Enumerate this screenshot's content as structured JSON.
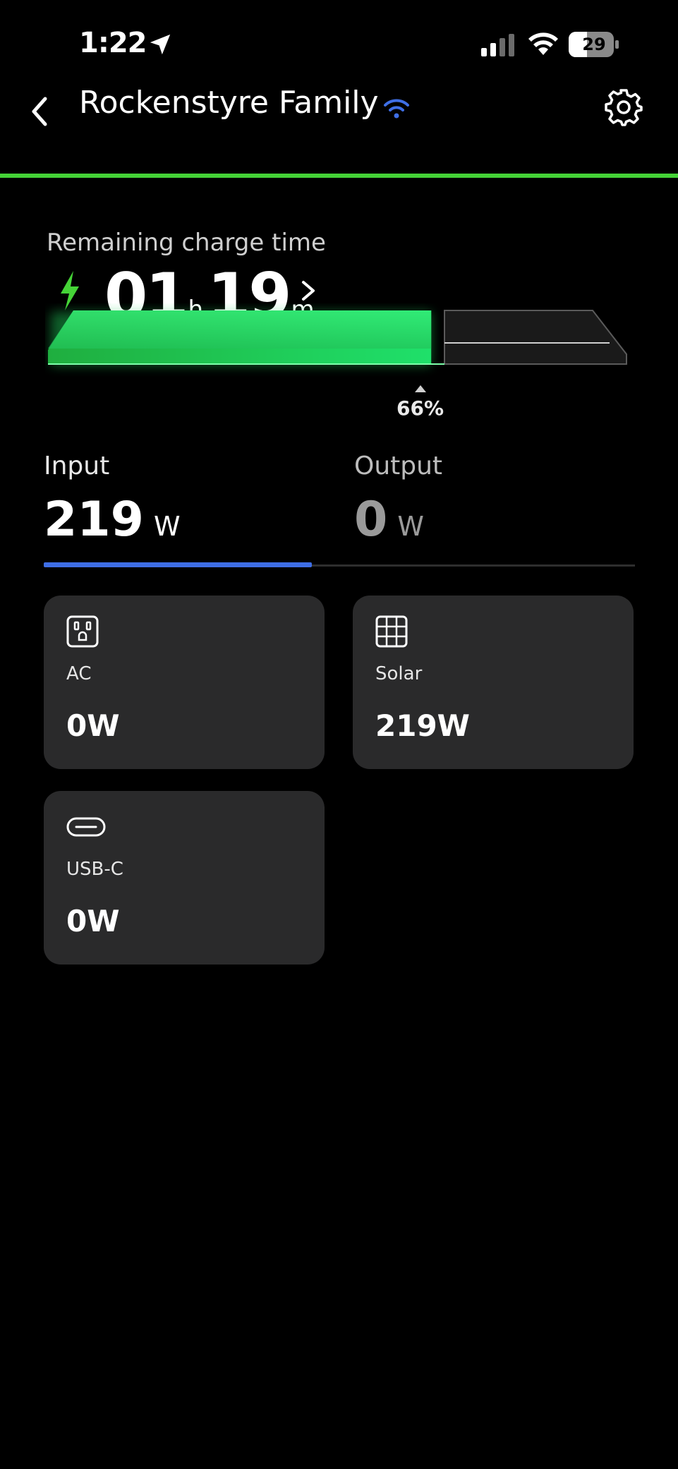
{
  "status_bar": {
    "time": "1:22",
    "battery_level": "29",
    "icons": [
      "location-arrow-icon",
      "cellular-signal-icon",
      "wifi-icon",
      "battery-icon"
    ]
  },
  "header": {
    "title": "Rockenstyre Family",
    "icons": [
      "back-chevron-icon",
      "wifi-connection-icon",
      "gear-icon"
    ]
  },
  "charge": {
    "label": "Remaining charge time",
    "hours": "01",
    "hours_unit": "h",
    "minutes": "19",
    "minutes_unit": "m",
    "percent_label": "66%",
    "percent_value": 66
  },
  "tabs": {
    "input": {
      "label": "Input",
      "value": "219",
      "unit": "W"
    },
    "output": {
      "label": "Output",
      "value": "0",
      "unit": "W"
    },
    "active": "input"
  },
  "cards": {
    "ac": {
      "label": "AC",
      "value": "0W",
      "icon": "ac-outlet-icon"
    },
    "solar": {
      "label": "Solar",
      "value": "219W",
      "icon": "solar-panel-icon"
    },
    "usbc": {
      "label": "USB-C",
      "value": "0W",
      "icon": "usb-c-port-icon"
    }
  },
  "colors": {
    "accent_green": "#45d337",
    "tab_indicator": "#3e6ee6",
    "card_bg": "#2a2a2b",
    "wifi_blue": "#3f6fe6"
  }
}
